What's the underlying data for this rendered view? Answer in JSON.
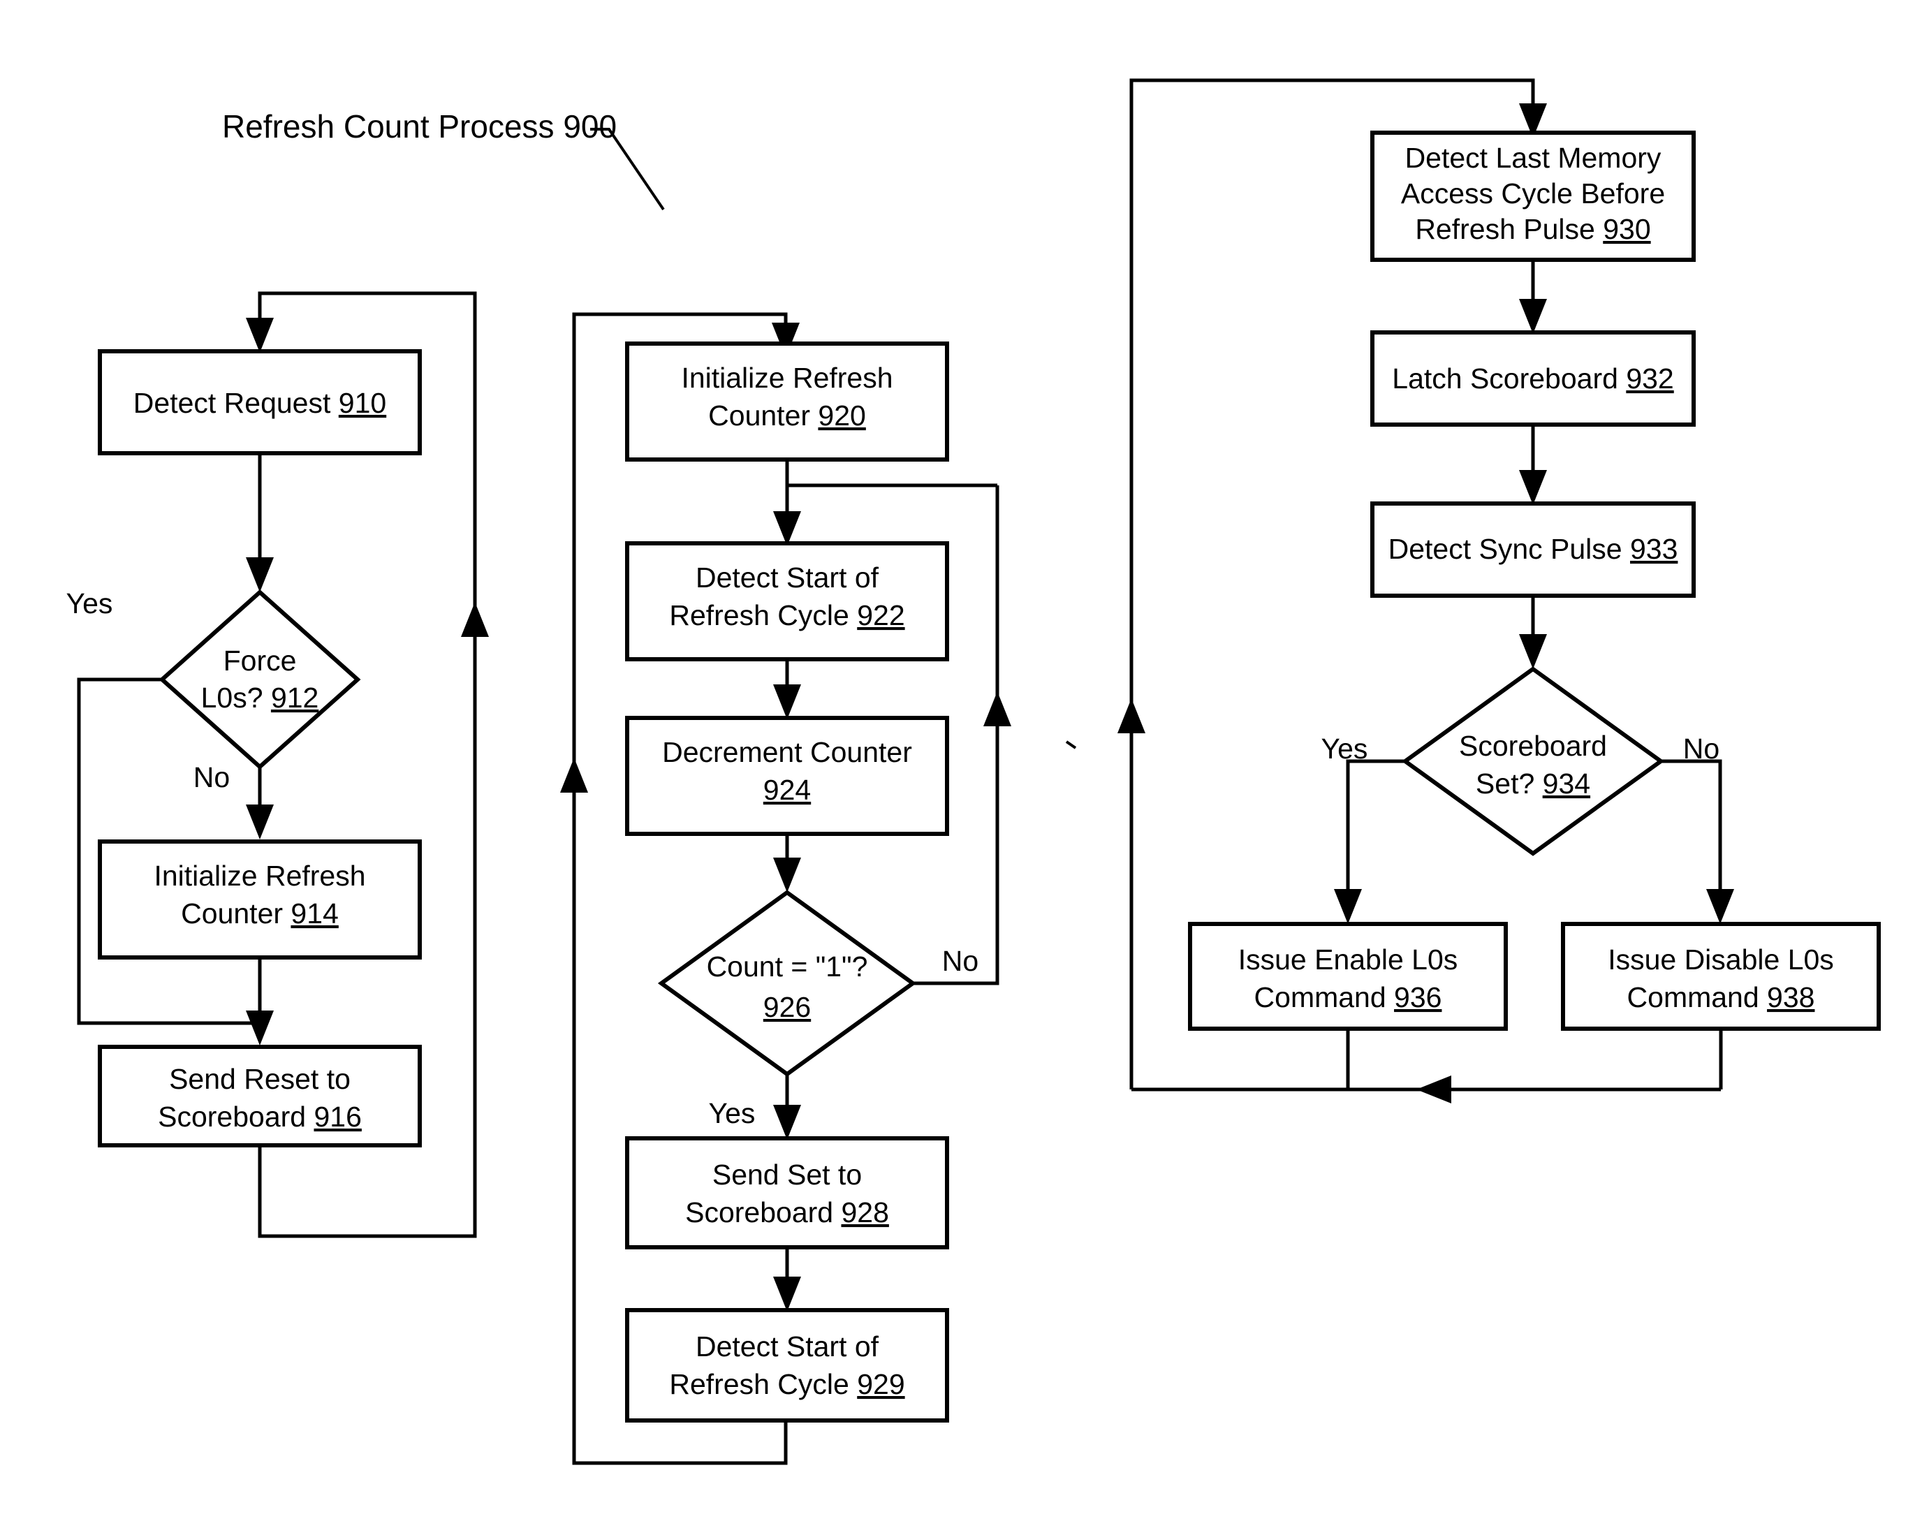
{
  "title": {
    "text": "Refresh Count Process 900"
  },
  "colors": {
    "stroke": "#000000",
    "fill": "#ffffff",
    "background": "#ffffff"
  },
  "nodes": {
    "n910": {
      "line1": "Detect Request ",
      "ref": "910",
      "shape": "process"
    },
    "n912": {
      "line1": "Force",
      "line2": "L0s? ",
      "ref": "912",
      "shape": "decision"
    },
    "n914": {
      "line1": "Initialize Refresh",
      "line2": "Counter ",
      "ref": "914",
      "shape": "process"
    },
    "n916": {
      "line1": "Send Reset to",
      "line2": "Scoreboard ",
      "ref": "916",
      "shape": "process"
    },
    "n920": {
      "line1": "Initialize Refresh",
      "line2": "Counter ",
      "ref": "920",
      "shape": "process"
    },
    "n922": {
      "line1": "Detect Start of",
      "line2": "Refresh Cycle ",
      "ref": "922",
      "shape": "process"
    },
    "n924": {
      "line1": "Decrement Counter",
      "line2": "",
      "ref": "924",
      "shape": "process"
    },
    "n926": {
      "line1": "Count = \"1\"?",
      "line2": "",
      "ref": "926",
      "shape": "decision"
    },
    "n928": {
      "line1": "Send Set to",
      "line2": "Scoreboard ",
      "ref": "928",
      "shape": "process"
    },
    "n929": {
      "line1": "Detect Start of",
      "line2": "Refresh Cycle ",
      "ref": "929",
      "shape": "process"
    },
    "n930": {
      "line1": "Detect Last Memory",
      "line2": "Access Cycle Before",
      "line3": "Refresh Pulse ",
      "ref": "930",
      "shape": "process"
    },
    "n932": {
      "line1": "Latch Scoreboard ",
      "ref": "932",
      "shape": "process"
    },
    "n933": {
      "line1": "Detect Sync Pulse ",
      "ref": "933",
      "shape": "process"
    },
    "n934": {
      "line1": "Scoreboard",
      "line2": "Set? ",
      "ref": "934",
      "shape": "decision"
    },
    "n936": {
      "line1": "Issue Enable L0s",
      "line2": "Command ",
      "ref": "936",
      "shape": "process"
    },
    "n938": {
      "line1": "Issue Disable L0s",
      "line2": "Command ",
      "ref": "938",
      "shape": "process"
    }
  },
  "edge_labels": {
    "e912_yes": "Yes",
    "e912_no": "No",
    "e926_no": "No",
    "e926_yes": "Yes",
    "e934_yes": "Yes",
    "e934_no": "No"
  }
}
